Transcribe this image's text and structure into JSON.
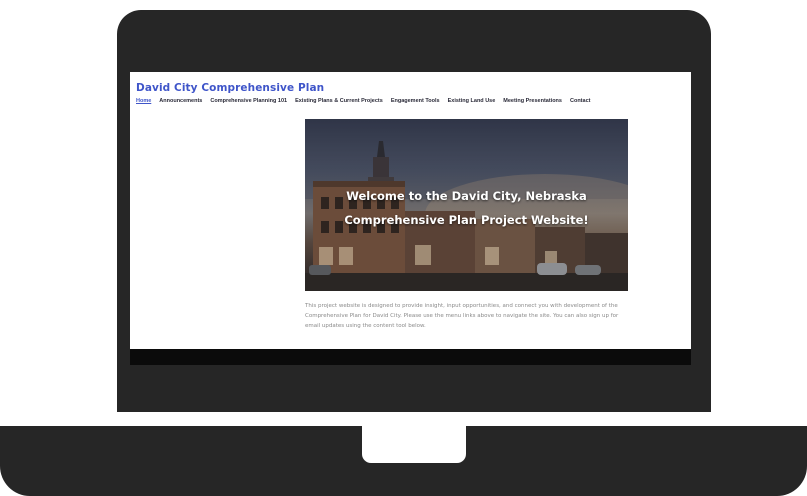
{
  "site": {
    "title": "David City Comprehensive Plan",
    "brand_color": "#3f55c9"
  },
  "nav": {
    "items": [
      {
        "label": "Home",
        "active": true
      },
      {
        "label": "Announcements",
        "active": false
      },
      {
        "label": "Comprehensive Planning 101",
        "active": false
      },
      {
        "label": "Existing Plans & Current Projects",
        "active": false
      },
      {
        "label": "Engagement Tools",
        "active": false
      },
      {
        "label": "Existing Land Use",
        "active": false
      },
      {
        "label": "Meeting Presentations",
        "active": false
      },
      {
        "label": "Contact",
        "active": false
      }
    ]
  },
  "hero": {
    "line1": "Welcome to the David City, Nebraska",
    "line2": "Comprehensive Plan Project Website!"
  },
  "intro": {
    "text": "This project website is designed to provide insight, input opportunities, and connect you with development of the Comprehensive Plan for David City. Please use the menu links above to navigate the site. You can also sign up for email updates using the content tool below."
  },
  "device": {
    "frame_color": "#262626"
  }
}
